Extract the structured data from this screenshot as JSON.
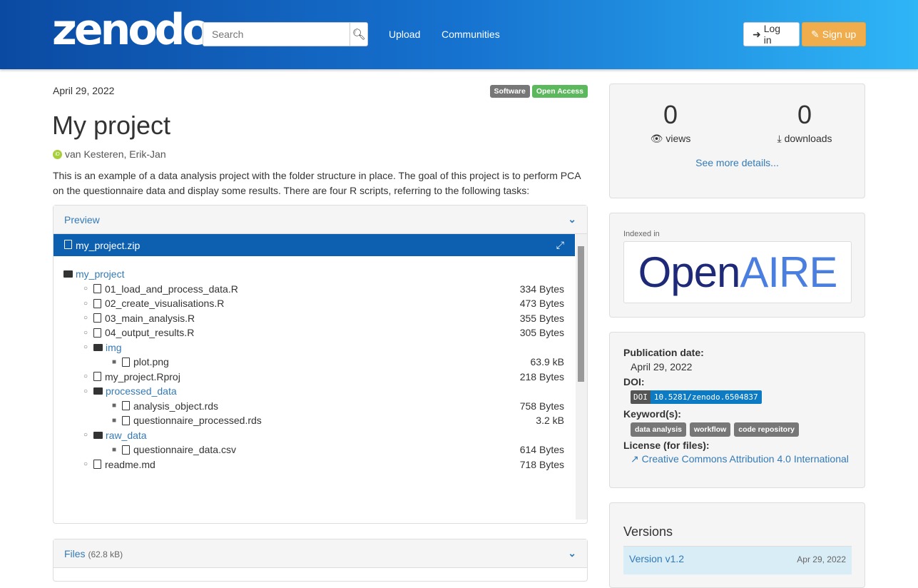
{
  "header": {
    "logo": "zenodo",
    "search_placeholder": "Search",
    "nav": [
      "Upload",
      "Communities"
    ],
    "login": "Log in",
    "signup": "Sign up"
  },
  "record": {
    "date": "April 29, 2022",
    "badges": [
      {
        "label": "Software",
        "color": "#777777"
      },
      {
        "label": "Open Access",
        "color": "#5cb85c"
      }
    ],
    "title": "My project",
    "author": "van Kesteren, Erik-Jan",
    "description": "This is an example of a data analysis project with the folder structure in place. The goal of this project is to perform PCA on the questionnaire data and display some results. There are four R scripts, referring to the following tasks:"
  },
  "preview": {
    "label": "Preview",
    "file": "my_project.zip",
    "tree": [
      {
        "name": "my_project",
        "type": "folder",
        "level": 0,
        "size": ""
      },
      {
        "name": "01_load_and_process_data.R",
        "type": "file",
        "level": 1,
        "size": "334 Bytes"
      },
      {
        "name": "02_create_visualisations.R",
        "type": "file",
        "level": 1,
        "size": "473 Bytes"
      },
      {
        "name": "03_main_analysis.R",
        "type": "file",
        "level": 1,
        "size": "355 Bytes"
      },
      {
        "name": "04_output_results.R",
        "type": "file",
        "level": 1,
        "size": "305 Bytes"
      },
      {
        "name": "img",
        "type": "folder",
        "level": 1,
        "size": ""
      },
      {
        "name": "plot.png",
        "type": "file",
        "level": 2,
        "size": "63.9 kB"
      },
      {
        "name": "my_project.Rproj",
        "type": "file",
        "level": 1,
        "size": "218 Bytes"
      },
      {
        "name": "processed_data",
        "type": "folder",
        "level": 1,
        "size": ""
      },
      {
        "name": "analysis_object.rds",
        "type": "file",
        "level": 2,
        "size": "758 Bytes"
      },
      {
        "name": "questionnaire_processed.rds",
        "type": "file",
        "level": 2,
        "size": "3.2 kB"
      },
      {
        "name": "raw_data",
        "type": "folder",
        "level": 1,
        "size": ""
      },
      {
        "name": "questionnaire_data.csv",
        "type": "file",
        "level": 2,
        "size": "614 Bytes"
      },
      {
        "name": "readme.md",
        "type": "file",
        "level": 1,
        "size": "718 Bytes"
      }
    ]
  },
  "files": {
    "label": "Files",
    "size": "(62.8 kB)"
  },
  "stats": {
    "views": "0",
    "views_label": "views",
    "downloads": "0",
    "downloads_label": "downloads",
    "more": "See more details..."
  },
  "indexed": {
    "label": "Indexed in",
    "logo_open": "Open",
    "logo_aire": "AIRE"
  },
  "meta": {
    "pub_label": "Publication date:",
    "pub_date": "April 29, 2022",
    "doi_label": "DOI:",
    "doi_prefix": "DOI",
    "doi": "10.5281/zenodo.6504837",
    "kw_label": "Keyword(s):",
    "keywords": [
      "data analysis",
      "workflow",
      "code repository"
    ],
    "license_label": "License (for files):",
    "license": "Creative Commons Attribution 4.0 International"
  },
  "versions": {
    "title": "Versions",
    "items": [
      {
        "label": "Version v1.2",
        "date": "Apr 29, 2022"
      }
    ]
  }
}
